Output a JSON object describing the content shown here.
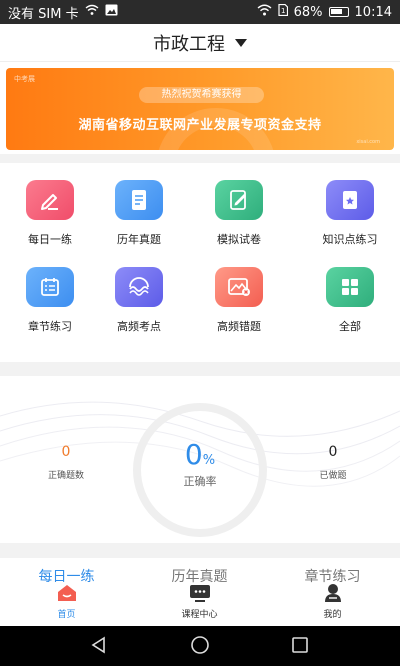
{
  "status_bar": {
    "carrier": "没有 SIM 卡",
    "battery": "68%",
    "time": "10:14"
  },
  "header": {
    "title": "市政工程"
  },
  "banner": {
    "logo_text": "中考展",
    "badge": "热烈祝贺希赛获得",
    "headline": "湖南省移动互联网产业发展专项资金支持",
    "footnote": "xisai.com"
  },
  "shortcuts": [
    {
      "label": "每日一练",
      "icon": "pencil-icon",
      "color": "#f3617a"
    },
    {
      "label": "历年真题",
      "icon": "document-icon",
      "color": "#4a9cf4"
    },
    {
      "label": "模拟试卷",
      "icon": "edit-paper-icon",
      "color": "#3dbd8a"
    },
    {
      "label": "知识点练习",
      "icon": "bookmark-star-icon",
      "color": "#6e6ef2"
    },
    {
      "label": "章节练习",
      "icon": "calendar-list-icon",
      "color": "#4a9cf4"
    },
    {
      "label": "高频考点",
      "icon": "wave-icon",
      "color": "#6e6ef2"
    },
    {
      "label": "高频错题",
      "icon": "error-image-icon",
      "color": "#fb7a6a"
    },
    {
      "label": "全部",
      "icon": "grid-icon",
      "color": "#3dbd8a"
    }
  ],
  "stats": {
    "correct_count": "0",
    "correct_count_label": "正确题数",
    "accuracy": "0",
    "accuracy_unit": "%",
    "accuracy_label": "正确率",
    "done_count": "0",
    "done_count_label": "已做题",
    "correct_count_color": "#f07b2b",
    "accuracy_color": "#2f8ce8"
  },
  "practice_tabs": [
    {
      "label": "每日一练",
      "active": true
    },
    {
      "label": "历年真题",
      "active": false
    },
    {
      "label": "章节练习",
      "active": false
    }
  ],
  "bottom_nav": [
    {
      "label": "首页",
      "icon": "home-icon",
      "active": true
    },
    {
      "label": "课程中心",
      "icon": "monitor-icon",
      "active": false
    },
    {
      "label": "我的",
      "icon": "user-icon",
      "active": false
    }
  ],
  "accent_color": "#2f8ce8"
}
